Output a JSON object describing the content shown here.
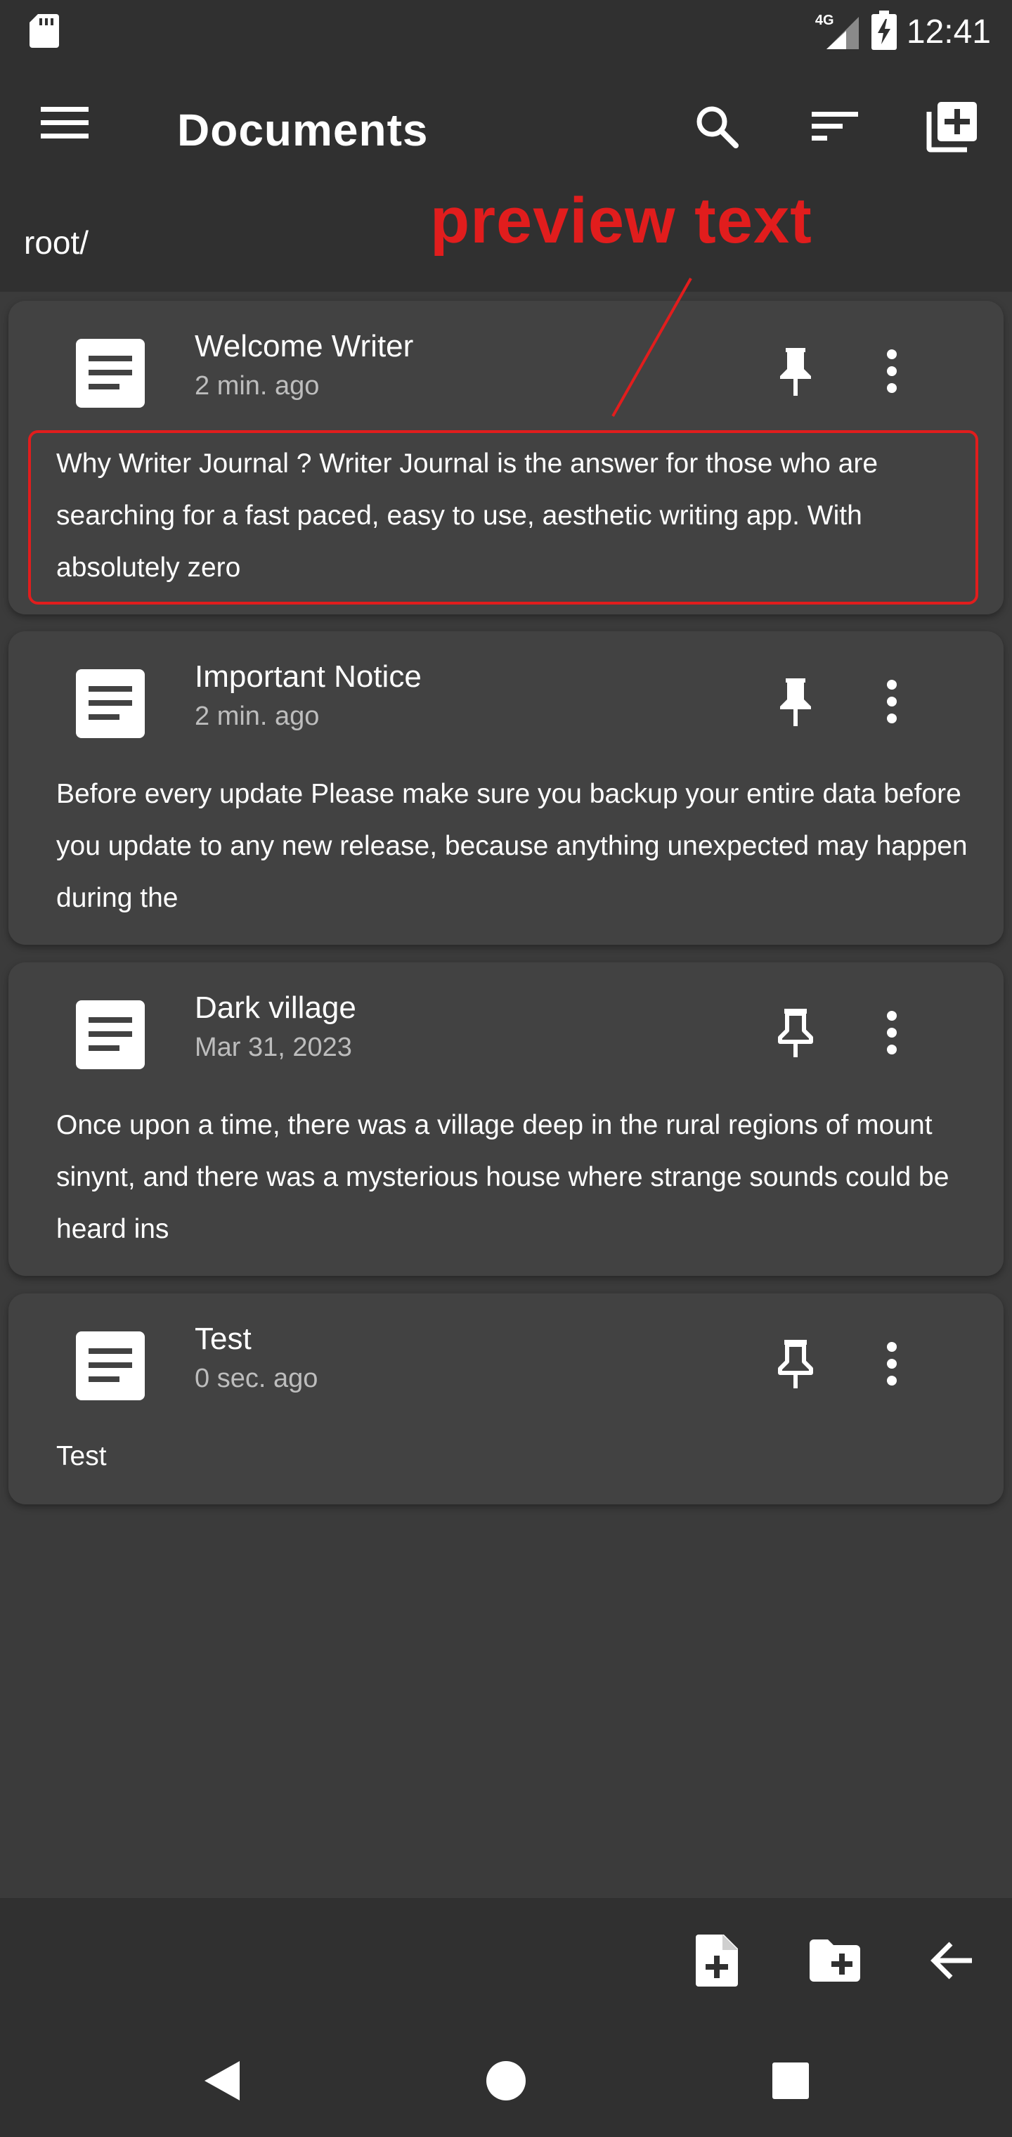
{
  "status_bar": {
    "time": "12:41",
    "network": "4G",
    "icons": [
      "sd-card-icon",
      "signal-icon",
      "battery-charging-icon"
    ]
  },
  "app_bar": {
    "title": "Documents",
    "icons": [
      "menu-icon",
      "search-icon",
      "sort-icon",
      "add-library-icon"
    ]
  },
  "path": "root/",
  "annotation": {
    "label": "preview text",
    "color": "#e11d1d"
  },
  "documents": [
    {
      "title": "Welcome Writer",
      "time": "2 min. ago",
      "preview": " Why Writer Journal ? Writer Journal is the answer for those who are searching for a fast paced, easy to use, aesthetic writing app. With absolutely zero",
      "pinned": true
    },
    {
      "title": "Important Notice",
      "time": "2 min. ago",
      "preview": " Before every update Please make sure you backup your entire data before you update to any new release, because anything unexpected may happen during the",
      "pinned": true
    },
    {
      "title": "Dark village",
      "time": "Mar 31, 2023",
      "preview": " Once upon a time, there was a village deep in the rural regions of mount sinynt, and there was a mysterious house where strange sounds could be heard ins",
      "pinned": false
    },
    {
      "title": "Test",
      "time": "0 sec. ago",
      "preview": "Test",
      "pinned": false
    }
  ],
  "bottom_toolbar": {
    "icons": [
      "new-file-icon",
      "new-folder-icon",
      "back-arrow-icon"
    ]
  },
  "nav_bar": {
    "icons": [
      "nav-back-icon",
      "nav-home-icon",
      "nav-recents-icon"
    ]
  },
  "colors": {
    "background": "#3b3b3b",
    "bars": "#303030",
    "card": "#424242",
    "annotation": "#e11d1d"
  }
}
